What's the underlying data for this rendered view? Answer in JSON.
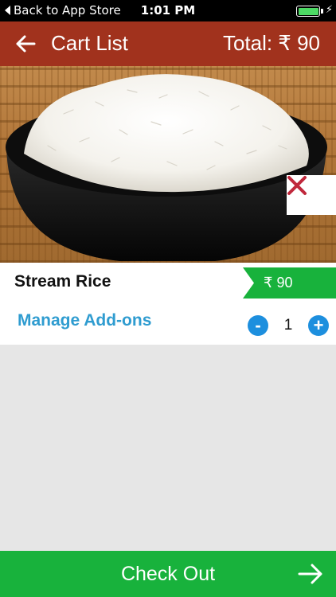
{
  "status_bar": {
    "back_label": "Back to App Store",
    "time": "1:01 PM"
  },
  "header": {
    "title": "Cart List",
    "total": "Total:  ₹ 90"
  },
  "cart_item": {
    "name": "Stream Rice",
    "price": "₹ 90",
    "manage_addons_label": "Manage Add-ons",
    "quantity": "1",
    "minus_symbol": "-",
    "plus_symbol": "+"
  },
  "checkout": {
    "label": "Check Out"
  },
  "colors": {
    "header_bg": "#a1321d",
    "accent_green": "#18b23c",
    "link_blue": "#2f9cd0",
    "qty_button_blue": "#1d8fde",
    "remove_red": "#c0283c"
  },
  "icons": {
    "back": "arrow-left-icon",
    "remove": "close-icon",
    "checkout": "arrow-right-icon",
    "battery": "battery-icon",
    "charging": "bolt-icon"
  }
}
